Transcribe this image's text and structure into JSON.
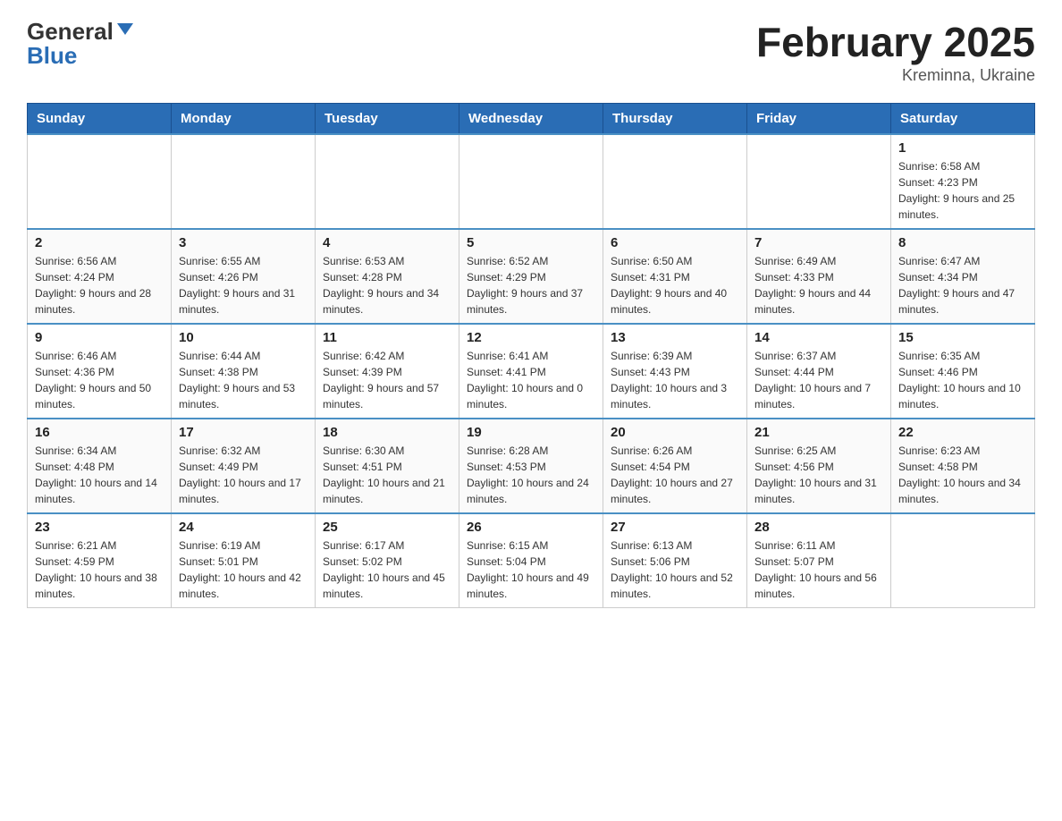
{
  "header": {
    "logo": {
      "general": "General",
      "blue": "Blue",
      "triangle": "▼"
    },
    "title": "February 2025",
    "location": "Kreminna, Ukraine"
  },
  "weekdays": [
    "Sunday",
    "Monday",
    "Tuesday",
    "Wednesday",
    "Thursday",
    "Friday",
    "Saturday"
  ],
  "weeks": [
    [
      {
        "day": "",
        "info": ""
      },
      {
        "day": "",
        "info": ""
      },
      {
        "day": "",
        "info": ""
      },
      {
        "day": "",
        "info": ""
      },
      {
        "day": "",
        "info": ""
      },
      {
        "day": "",
        "info": ""
      },
      {
        "day": "1",
        "info": "Sunrise: 6:58 AM\nSunset: 4:23 PM\nDaylight: 9 hours and 25 minutes."
      }
    ],
    [
      {
        "day": "2",
        "info": "Sunrise: 6:56 AM\nSunset: 4:24 PM\nDaylight: 9 hours and 28 minutes."
      },
      {
        "day": "3",
        "info": "Sunrise: 6:55 AM\nSunset: 4:26 PM\nDaylight: 9 hours and 31 minutes."
      },
      {
        "day": "4",
        "info": "Sunrise: 6:53 AM\nSunset: 4:28 PM\nDaylight: 9 hours and 34 minutes."
      },
      {
        "day": "5",
        "info": "Sunrise: 6:52 AM\nSunset: 4:29 PM\nDaylight: 9 hours and 37 minutes."
      },
      {
        "day": "6",
        "info": "Sunrise: 6:50 AM\nSunset: 4:31 PM\nDaylight: 9 hours and 40 minutes."
      },
      {
        "day": "7",
        "info": "Sunrise: 6:49 AM\nSunset: 4:33 PM\nDaylight: 9 hours and 44 minutes."
      },
      {
        "day": "8",
        "info": "Sunrise: 6:47 AM\nSunset: 4:34 PM\nDaylight: 9 hours and 47 minutes."
      }
    ],
    [
      {
        "day": "9",
        "info": "Sunrise: 6:46 AM\nSunset: 4:36 PM\nDaylight: 9 hours and 50 minutes."
      },
      {
        "day": "10",
        "info": "Sunrise: 6:44 AM\nSunset: 4:38 PM\nDaylight: 9 hours and 53 minutes."
      },
      {
        "day": "11",
        "info": "Sunrise: 6:42 AM\nSunset: 4:39 PM\nDaylight: 9 hours and 57 minutes."
      },
      {
        "day": "12",
        "info": "Sunrise: 6:41 AM\nSunset: 4:41 PM\nDaylight: 10 hours and 0 minutes."
      },
      {
        "day": "13",
        "info": "Sunrise: 6:39 AM\nSunset: 4:43 PM\nDaylight: 10 hours and 3 minutes."
      },
      {
        "day": "14",
        "info": "Sunrise: 6:37 AM\nSunset: 4:44 PM\nDaylight: 10 hours and 7 minutes."
      },
      {
        "day": "15",
        "info": "Sunrise: 6:35 AM\nSunset: 4:46 PM\nDaylight: 10 hours and 10 minutes."
      }
    ],
    [
      {
        "day": "16",
        "info": "Sunrise: 6:34 AM\nSunset: 4:48 PM\nDaylight: 10 hours and 14 minutes."
      },
      {
        "day": "17",
        "info": "Sunrise: 6:32 AM\nSunset: 4:49 PM\nDaylight: 10 hours and 17 minutes."
      },
      {
        "day": "18",
        "info": "Sunrise: 6:30 AM\nSunset: 4:51 PM\nDaylight: 10 hours and 21 minutes."
      },
      {
        "day": "19",
        "info": "Sunrise: 6:28 AM\nSunset: 4:53 PM\nDaylight: 10 hours and 24 minutes."
      },
      {
        "day": "20",
        "info": "Sunrise: 6:26 AM\nSunset: 4:54 PM\nDaylight: 10 hours and 27 minutes."
      },
      {
        "day": "21",
        "info": "Sunrise: 6:25 AM\nSunset: 4:56 PM\nDaylight: 10 hours and 31 minutes."
      },
      {
        "day": "22",
        "info": "Sunrise: 6:23 AM\nSunset: 4:58 PM\nDaylight: 10 hours and 34 minutes."
      }
    ],
    [
      {
        "day": "23",
        "info": "Sunrise: 6:21 AM\nSunset: 4:59 PM\nDaylight: 10 hours and 38 minutes."
      },
      {
        "day": "24",
        "info": "Sunrise: 6:19 AM\nSunset: 5:01 PM\nDaylight: 10 hours and 42 minutes."
      },
      {
        "day": "25",
        "info": "Sunrise: 6:17 AM\nSunset: 5:02 PM\nDaylight: 10 hours and 45 minutes."
      },
      {
        "day": "26",
        "info": "Sunrise: 6:15 AM\nSunset: 5:04 PM\nDaylight: 10 hours and 49 minutes."
      },
      {
        "day": "27",
        "info": "Sunrise: 6:13 AM\nSunset: 5:06 PM\nDaylight: 10 hours and 52 minutes."
      },
      {
        "day": "28",
        "info": "Sunrise: 6:11 AM\nSunset: 5:07 PM\nDaylight: 10 hours and 56 minutes."
      },
      {
        "day": "",
        "info": ""
      }
    ]
  ]
}
